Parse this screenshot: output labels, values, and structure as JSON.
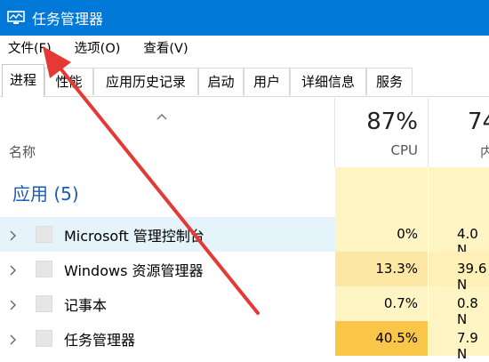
{
  "window": {
    "title": "任务管理器"
  },
  "menu": {
    "file": "文件(F)",
    "options": "选项(O)",
    "view": "查看(V)"
  },
  "tabs": [
    "进程",
    "性能",
    "应用历史记录",
    "启动",
    "用户",
    "详细信息",
    "服务"
  ],
  "header": {
    "name_label": "名称",
    "cpu_percent": "87%",
    "cpu_label": "CPU",
    "mem_percent": "74",
    "mem_label": "内"
  },
  "group": {
    "label": "应用 (5)"
  },
  "processes": [
    {
      "name": "Microsoft 管理控制台",
      "cpu": "0%",
      "mem": "4.0 N"
    },
    {
      "name": "Windows 资源管理器",
      "cpu": "13.3%",
      "mem": "39.6 N"
    },
    {
      "name": "记事本",
      "cpu": "0.7%",
      "mem": "0.8 N"
    },
    {
      "name": "任务管理器",
      "cpu": "40.5%",
      "mem": "7.9 N"
    }
  ],
  "colors": {
    "titlebar": "#0078d7",
    "group_heading": "#1a5bb8",
    "annotation_arrow": "#e53935"
  }
}
